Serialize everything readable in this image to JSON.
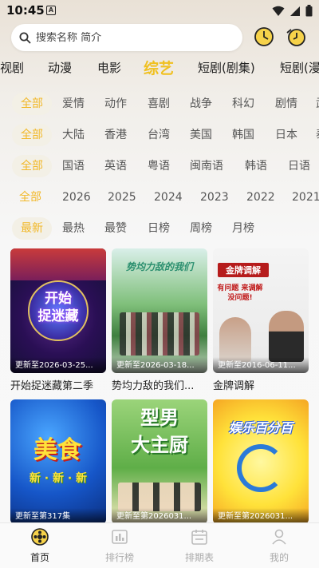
{
  "status": {
    "time": "10:45",
    "notif_badge": "A"
  },
  "search": {
    "placeholder": "搜索名称 简介"
  },
  "categories": [
    "视剧",
    "动漫",
    "电影",
    "综艺",
    "短剧(剧集)",
    "短剧(漫"
  ],
  "active_category": "综艺",
  "filters": {
    "genre": [
      "全部",
      "爱情",
      "动作",
      "喜剧",
      "战争",
      "科幻",
      "剧情",
      "武"
    ],
    "region": [
      "全部",
      "大陆",
      "香港",
      "台湾",
      "美国",
      "韩国",
      "日本",
      "泰"
    ],
    "language": [
      "全部",
      "国语",
      "英语",
      "粤语",
      "闽南语",
      "韩语",
      "日语"
    ],
    "year": [
      "全部",
      "2026",
      "2025",
      "2024",
      "2023",
      "2022",
      "2021"
    ],
    "sort": [
      "最新",
      "最热",
      "最赞",
      "日榜",
      "周榜",
      "月榜"
    ]
  },
  "cards": [
    {
      "title": "开始捉迷藏第二季",
      "update": "更新至2026-03-25...",
      "poster_text": "开始\n捉迷藏"
    },
    {
      "title": "势均力敌的我们...",
      "update": "更新至2026-03-18...",
      "poster_text": "势均力敌的我们"
    },
    {
      "title": "金牌调解",
      "update": "更新至2016-06-11...",
      "poster_text": "金牌调解"
    },
    {
      "title": "",
      "update": "更新至第317集",
      "poster_text": "美食"
    },
    {
      "title": "",
      "update": "更新至第2026031...",
      "poster_text": "型男\n大主厨"
    },
    {
      "title": "",
      "update": "更新至第2026031...",
      "poster_text": "娱乐百分百"
    }
  ],
  "poster_extra": {
    "jinpai_slogan": "有问题 来调解 没问题!",
    "meishi_sub": "新 · 新 · 新"
  },
  "nav": [
    {
      "label": "首页",
      "icon": "home-icon",
      "active": true
    },
    {
      "label": "排行榜",
      "icon": "rank-icon",
      "active": false
    },
    {
      "label": "排期表",
      "icon": "schedule-icon",
      "active": false
    },
    {
      "label": "我的",
      "icon": "profile-icon",
      "active": false
    }
  ],
  "colors": {
    "accent": "#f2b829",
    "active_chip_bg": "#f3f0e6"
  }
}
